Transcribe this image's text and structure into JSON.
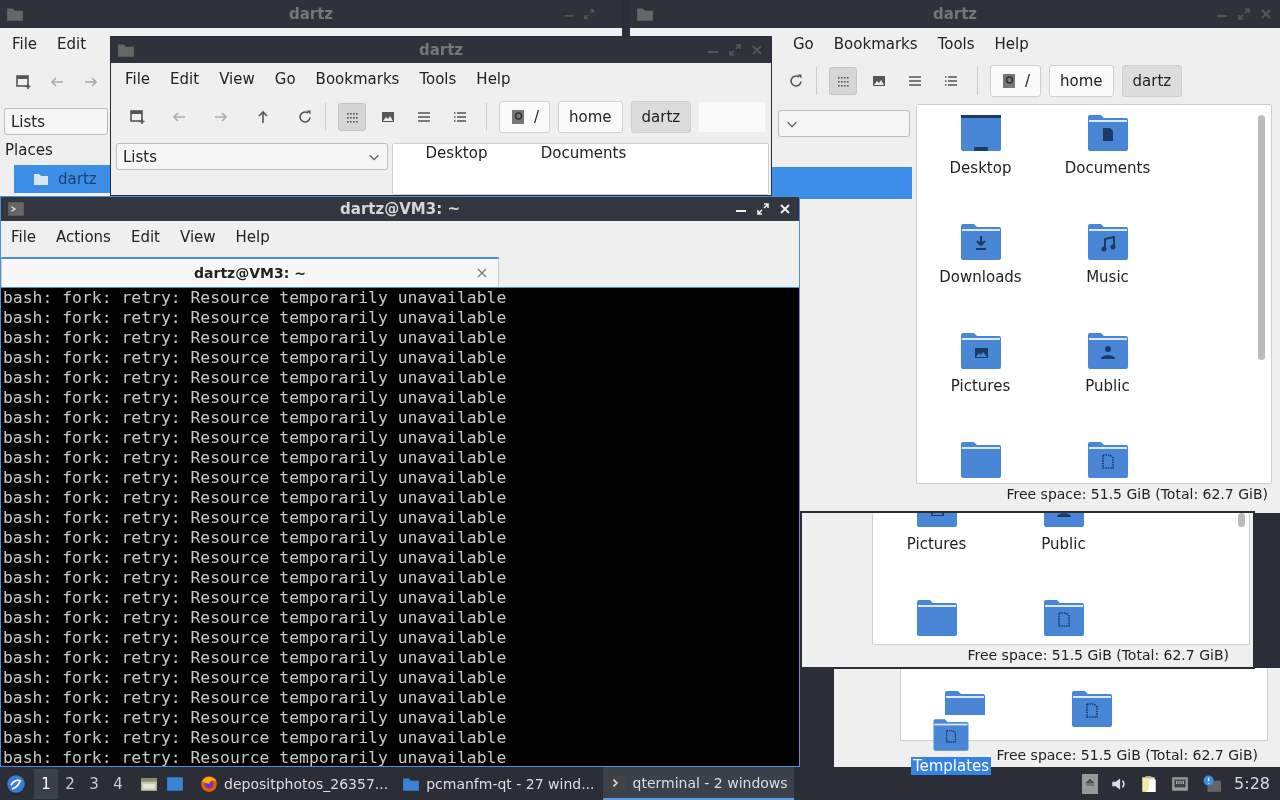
{
  "back_window": {
    "title": "dartz",
    "active": false,
    "menu": [
      "File",
      "Edit"
    ],
    "combo": "Lists",
    "places_heading": "Places",
    "places": [
      {
        "label": "dartz",
        "selected": true
      }
    ]
  },
  "right_window": {
    "title": "dartz",
    "active": false,
    "menu": [
      "Go",
      "Bookmarks",
      "Tools",
      "Help"
    ],
    "view_modes": [
      {
        "selected": true
      },
      {
        "selected": false
      },
      {
        "selected": false
      },
      {
        "selected": false
      }
    ],
    "path": [
      {
        "label": "/",
        "selected": false
      },
      {
        "label": "home",
        "selected": false
      },
      {
        "label": "dartz",
        "selected": true
      }
    ],
    "folders": [
      {
        "label": "Desktop",
        "kind": "desktop"
      },
      {
        "label": "Documents",
        "kind": "documents"
      },
      {
        "label": "Downloads",
        "kind": "downloads"
      },
      {
        "label": "Music",
        "kind": "music"
      },
      {
        "label": "Pictures",
        "kind": "pictures"
      },
      {
        "label": "Public",
        "kind": "public"
      },
      {
        "kind": "plain"
      },
      {
        "kind": "templates"
      }
    ],
    "status": "Free space: 51.5 GiB (Total: 62.7 GiB)"
  },
  "middle_window": {
    "title": "dartz",
    "active": false,
    "menu": [
      "File",
      "Edit",
      "View",
      "Go",
      "Bookmarks",
      "Tools",
      "Help"
    ],
    "view_modes": [
      {
        "selected": true
      },
      {
        "selected": false
      },
      {
        "selected": false
      },
      {
        "selected": false
      }
    ],
    "path": [
      {
        "label": "/",
        "selected": false
      },
      {
        "label": "home",
        "selected": false
      },
      {
        "label": "dartz",
        "selected": true
      }
    ],
    "combo": "Lists",
    "files": [
      "Desktop",
      "Documents"
    ]
  },
  "lower_window_1": {
    "folders": [
      {
        "label": "Pictures",
        "kind": "pictures"
      },
      {
        "label": "Public",
        "kind": "public"
      },
      {
        "kind": "plain"
      },
      {
        "kind": "templates"
      }
    ],
    "status": "Free space: 51.5 GiB (Total: 62.7 GiB)"
  },
  "lower_window_2": {
    "folders": [
      {
        "kind": "plain"
      },
      {
        "kind": "templates"
      }
    ],
    "status": "Free space: 51.5 GiB (Total: 62.7 GiB)"
  },
  "drag": {
    "label": "Templates",
    "kind": "templates"
  },
  "terminal": {
    "title": "dartz@VM3: ~",
    "active": true,
    "menu": [
      "File",
      "Actions",
      "Edit",
      "View",
      "Help"
    ],
    "tabs": [
      {
        "label": "dartz@VM3: ~",
        "selected": true
      }
    ],
    "lines": [
      "bash: fork: retry: Resource temporarily unavailable",
      "bash: fork: retry: Resource temporarily unavailable",
      "bash: fork: retry: Resource temporarily unavailable",
      "bash: fork: retry: Resource temporarily unavailable",
      "bash: fork: retry: Resource temporarily unavailable",
      "bash: fork: retry: Resource temporarily unavailable",
      "bash: fork: retry: Resource temporarily unavailable",
      "bash: fork: retry: Resource temporarily unavailable",
      "bash: fork: retry: Resource temporarily unavailable",
      "bash: fork: retry: Resource temporarily unavailable",
      "bash: fork: retry: Resource temporarily unavailable",
      "bash: fork: retry: Resource temporarily unavailable",
      "bash: fork: retry: Resource temporarily unavailable",
      "bash: fork: retry: Resource temporarily unavailable",
      "bash: fork: retry: Resource temporarily unavailable",
      "bash: fork: retry: Resource temporarily unavailable",
      "bash: fork: retry: Resource temporarily unavailable",
      "bash: fork: retry: Resource temporarily unavailable",
      "bash: fork: retry: Resource temporarily unavailable",
      "bash: fork: retry: Resource temporarily unavailable",
      "bash: fork: retry: Resource temporarily unavailable",
      "bash: fork: retry: Resource temporarily unavailable",
      "bash: fork: retry: Resource temporarily unavailable",
      "bash: fork: retry: Resource temporarily unavailable"
    ]
  },
  "taskbar": {
    "workspaces": [
      {
        "label": "1",
        "selected": true
      },
      {
        "label": "2",
        "selected": false
      },
      {
        "label": "3",
        "selected": false
      },
      {
        "label": "4",
        "selected": false
      }
    ],
    "tasks": [
      {
        "label": "depositphotos_26357...",
        "kind": "browser",
        "selected": false
      },
      {
        "label": "pcmanfm-qt - 27 wind...",
        "kind": "files",
        "selected": false
      },
      {
        "label": "qterminal - 2 windows",
        "kind": "terminal",
        "selected": true
      }
    ],
    "clock": "5:28"
  }
}
